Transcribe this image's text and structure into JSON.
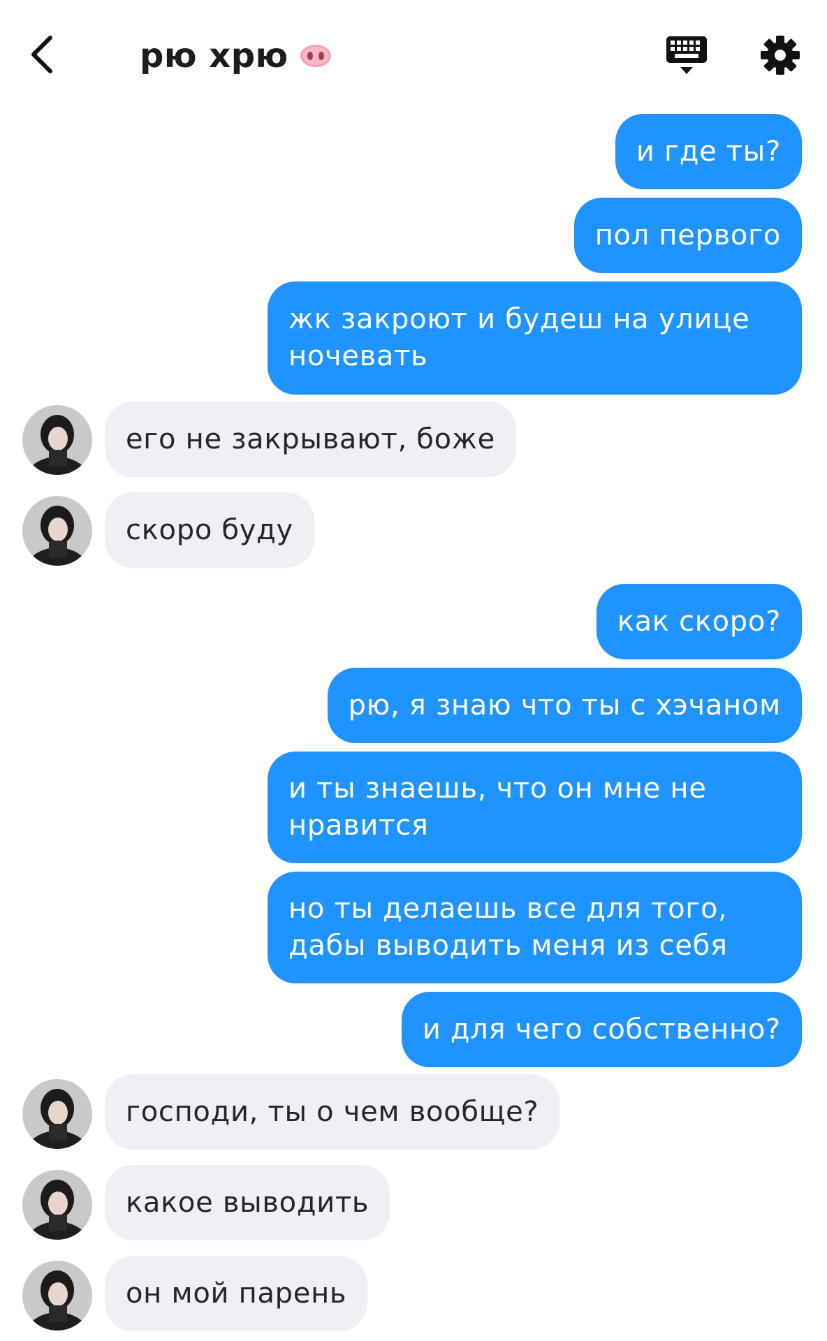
{
  "header": {
    "title": "рю хрю",
    "title_emoji_icon": "pig-nose-icon",
    "back_icon": "chevron-left-icon",
    "keyboard_icon": "keyboard-icon",
    "settings_icon": "gear-icon"
  },
  "colors": {
    "outgoing": "#1f93ff",
    "incoming": "#efeff4",
    "background": "#ffffff"
  },
  "messages": [
    {
      "side": "out",
      "text": "и где ты?"
    },
    {
      "side": "out",
      "text": "пол первого"
    },
    {
      "side": "out",
      "text": "жк закроют и будеш на улице ночевать"
    },
    {
      "side": "in",
      "text": "его не закрывают, боже"
    },
    {
      "side": "in",
      "text": "скоро буду"
    },
    {
      "side": "out",
      "text": "как скоро?"
    },
    {
      "side": "out",
      "text": "рю, я знаю что ты с хэчаном"
    },
    {
      "side": "out",
      "text": "и ты знаешь, что он мне не нравится"
    },
    {
      "side": "out",
      "text": "но ты делаешь все для того, дабы выводить меня из себя"
    },
    {
      "side": "out",
      "text": "и для чего собственно?"
    },
    {
      "side": "in",
      "text": "господи, ты о чем вообще?"
    },
    {
      "side": "in",
      "text": "какое выводить"
    },
    {
      "side": "in",
      "text": "он мой парень"
    }
  ]
}
